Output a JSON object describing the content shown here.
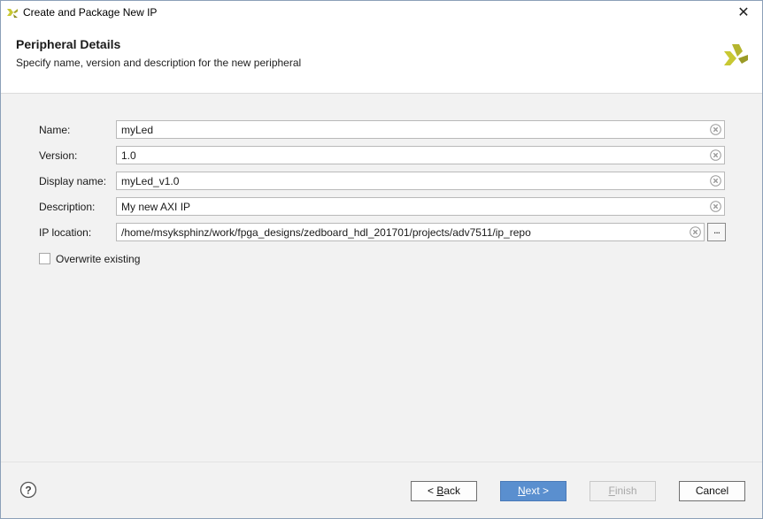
{
  "window": {
    "title": "Create and Package New IP"
  },
  "header": {
    "title": "Peripheral Details",
    "subtitle": "Specify name, version and description for the new peripheral"
  },
  "form": {
    "name": {
      "label": "Name:",
      "value": "myLed"
    },
    "version": {
      "label": "Version:",
      "value": "1.0"
    },
    "display_name": {
      "label": "Display name:",
      "value": "myLed_v1.0"
    },
    "description": {
      "label": "Description:",
      "value": "My new AXI IP"
    },
    "ip_location": {
      "label": "IP location:",
      "value": "/home/msyksphinz/work/fpga_designs/zedboard_hdl_201701/projects/adv7511/ip_repo",
      "browse_label": "..."
    },
    "overwrite": {
      "label": "Overwrite existing",
      "checked": false
    }
  },
  "footer": {
    "help_label": "?",
    "back_prefix": "< ",
    "back_mnemonic": "B",
    "back_rest": "ack",
    "next_mnemonic": "N",
    "next_rest": "ext >",
    "finish_mnemonic": "F",
    "finish_rest": "inish",
    "cancel_label": "Cancel"
  },
  "colors": {
    "brand_yellow": "#c8c832",
    "accent_blue": "#5a8fcf"
  },
  "icons": {
    "logo": "xilinx-logo-icon",
    "clear": "clear-circle-icon",
    "help": "help-circle-icon",
    "close": "close-icon"
  }
}
